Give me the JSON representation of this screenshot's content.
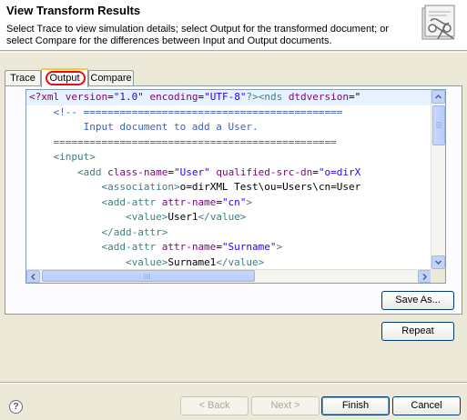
{
  "header": {
    "title": "View Transform Results",
    "description": "Select Trace to view simulation details; select Output for the transformed document; or select Compare for the differences between Input and Output documents."
  },
  "tabs": [
    {
      "label": "Trace"
    },
    {
      "label": "Output"
    },
    {
      "label": "Compare"
    }
  ],
  "editor": {
    "lines": [
      [
        "<?xml ",
        "version",
        "=",
        "\"1.0\"",
        " ",
        "encoding",
        "=",
        "\"UTF-8\"",
        "?><nds ",
        "dtdversion",
        "=\""
      ],
      [
        "    <!-- ===========================================",
        "",
        "",
        "",
        "",
        "",
        "",
        "",
        "",
        "",
        ""
      ],
      [
        "         Input document to add a User.",
        "",
        "",
        "",
        "",
        "",
        "",
        "",
        "",
        "",
        ""
      ],
      [
        "    ===============================================",
        "",
        "",
        "",
        "",
        "",
        "",
        "",
        "",
        "",
        ""
      ],
      [
        "    <input>",
        "",
        "",
        "",
        "",
        "",
        "",
        "",
        "",
        "",
        ""
      ],
      [
        "        <add ",
        "class-name",
        "=",
        "\"User\"",
        " ",
        "qualified-src-dn",
        "=",
        "\"o=dirX",
        "",
        "",
        ""
      ],
      [
        "            <association>",
        "o=dirXML Test\\ou=Users\\cn=User",
        "",
        "",
        "",
        "",
        "",
        "",
        "",
        "",
        ""
      ],
      [
        "            <add-attr ",
        "attr-name",
        "=",
        "\"cn\"",
        ">",
        "",
        "",
        "",
        "",
        "",
        ""
      ],
      [
        "                <value>",
        "User1",
        "</value>",
        "",
        "",
        "",
        "",
        "",
        "",
        "",
        ""
      ],
      [
        "            </add-attr>",
        "",
        "",
        "",
        "",
        "",
        "",
        "",
        "",
        "",
        ""
      ],
      [
        "            <add-attr ",
        "attr-name",
        "=",
        "\"Surname\"",
        ">",
        "",
        "",
        "",
        "",
        "",
        ""
      ],
      [
        "                <value>",
        "Surname1",
        "</value>",
        "",
        "",
        "",
        "",
        "",
        "",
        "",
        ""
      ]
    ]
  },
  "buttons": {
    "save_as": "Save As...",
    "repeat": "Repeat",
    "back": "< Back",
    "next": "Next >",
    "finish": "Finish",
    "cancel": "Cancel"
  },
  "help": {
    "symbol": "?"
  }
}
